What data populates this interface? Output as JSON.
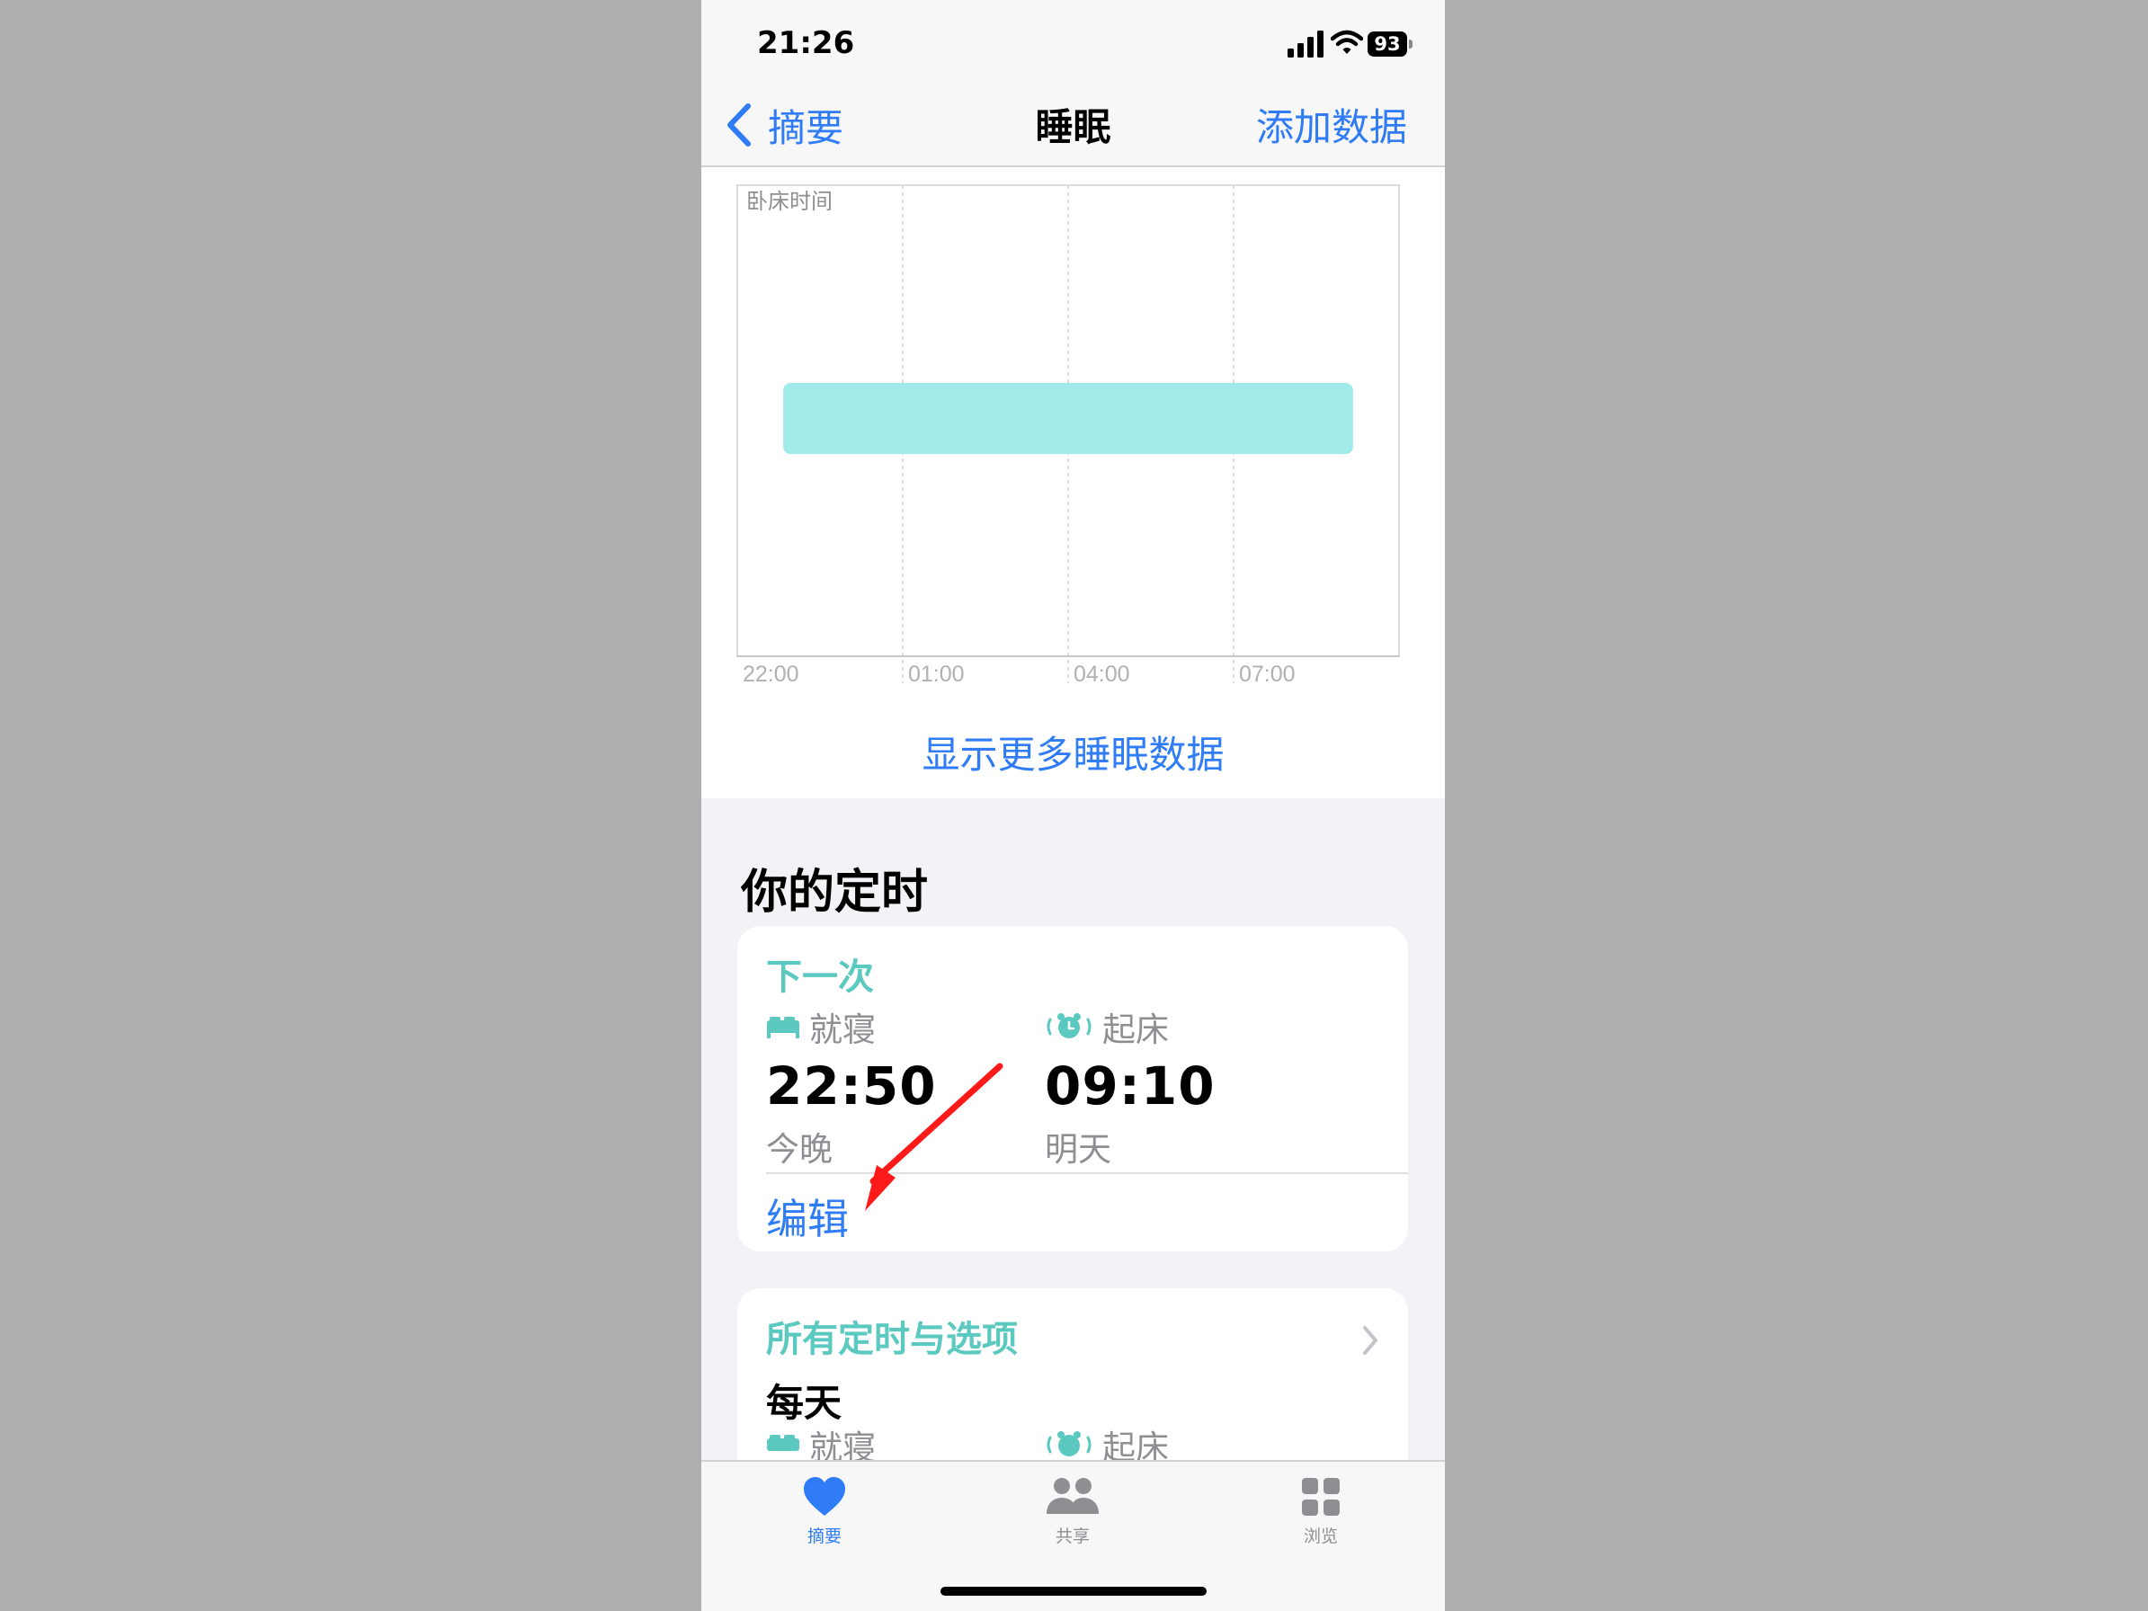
{
  "status_bar": {
    "time": "21:26",
    "battery": "93"
  },
  "nav": {
    "back_label": "摘要",
    "title": "睡眠",
    "action_label": "添加数据"
  },
  "chart_data": {
    "type": "bar",
    "title": "",
    "legend_label": "卧床时间",
    "x_ticks": [
      "22:00",
      "01:00",
      "04:00",
      "07:00"
    ],
    "x_range": [
      "22:00",
      "10:00"
    ],
    "series": [
      {
        "name": "卧床时间",
        "start": "22:50",
        "end": "09:10",
        "color": "#a0eaea"
      }
    ],
    "grid": true
  },
  "more_link": "显示更多睡眠数据",
  "schedule": {
    "section_title": "你的定时",
    "next": {
      "heading": "下一次",
      "bedtime": {
        "label": "就寝",
        "time": "22:50",
        "day": "今晚"
      },
      "wake": {
        "label": "起床",
        "time": "09:10",
        "day": "明天"
      },
      "edit_label": "编辑"
    },
    "all": {
      "heading": "所有定时与选项",
      "frequency": "每天",
      "bedtime_label": "就寝",
      "wake_label": "起床"
    }
  },
  "tabs": [
    {
      "label": "摘要",
      "icon": "heart-icon",
      "active": true
    },
    {
      "label": "共享",
      "icon": "people-icon",
      "active": false
    },
    {
      "label": "浏览",
      "icon": "grid-icon",
      "active": false
    }
  ],
  "colors": {
    "accent": "#2f7cf6",
    "teal": "#5bc9c0",
    "bar": "#a0eaea",
    "annotation": "#ff1a1a"
  }
}
